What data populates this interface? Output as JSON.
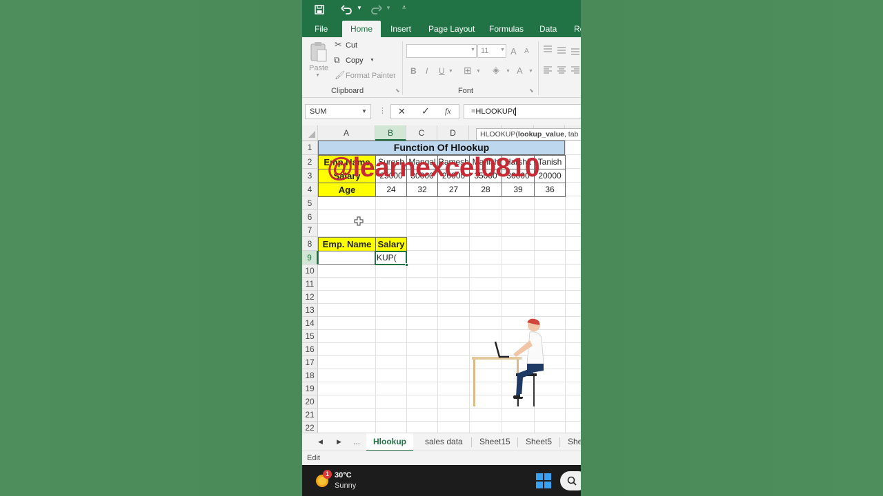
{
  "quick_access": {
    "save_icon": "save-icon",
    "undo_icon": "undo-icon",
    "redo_icon": "redo-icon",
    "customize_icon": "customize-icon"
  },
  "ribbon_tabs": [
    "File",
    "Home",
    "Insert",
    "Page Layout",
    "Formulas",
    "Data",
    "Re"
  ],
  "active_tab": "Home",
  "clipboard": {
    "paste": "Paste",
    "cut": "Cut",
    "copy": "Copy",
    "format_painter": "Format Painter",
    "group_label": "Clipboard"
  },
  "font": {
    "size": "11",
    "group_label": "Font",
    "bold": "B",
    "italic": "I",
    "underline": "U",
    "grow": "A",
    "shrink": "A",
    "color": "A"
  },
  "formula_bar": {
    "name_box": "SUM",
    "fx": "fx",
    "formula": "=HLOOKUP(",
    "tooltip_prefix": "HLOOKUP(",
    "tooltip_bold": "lookup_value",
    "tooltip_suffix": ", tab"
  },
  "columns": [
    "A",
    "B",
    "C",
    "D"
  ],
  "rows": [
    "1",
    "2",
    "3",
    "4",
    "5",
    "6",
    "7",
    "8",
    "9",
    "10",
    "11",
    "12",
    "13",
    "14",
    "15",
    "16",
    "17",
    "18",
    "19",
    "20",
    "21",
    "22"
  ],
  "table": {
    "title": "Function Of Hlookup",
    "row2": [
      "Emp.Name",
      "Suresh",
      "Mangal",
      "Ramesh",
      "Manish",
      "Harshit",
      "Tanish"
    ],
    "row3": [
      "Salary",
      "25000",
      "30000",
      "20000",
      "35000",
      "30000",
      "20000"
    ],
    "row4": [
      "Age",
      "24",
      "32",
      "27",
      "28",
      "39",
      "36"
    ]
  },
  "lookup": {
    "header_a": "Emp. Name",
    "header_b": "Salary",
    "active_cell_text": "KUP("
  },
  "watermark": "@learnexcel0810",
  "sheet_tabs": [
    "Hlookup",
    "sales data",
    "Sheet15",
    "Sheet5",
    "She"
  ],
  "active_sheet": "Hlookup",
  "sheet_nav": {
    "prev_icon": "prev-sheet-icon",
    "next_icon": "next-sheet-icon",
    "more": "..."
  },
  "status": "Edit",
  "weather": {
    "temp": "30°C",
    "desc": "Sunny",
    "badge": "1"
  },
  "colors": {
    "excel_green": "#217346",
    "title_fill": "#bdd7ee",
    "header_fill": "#ffff00",
    "watermark": "#c62a34"
  }
}
